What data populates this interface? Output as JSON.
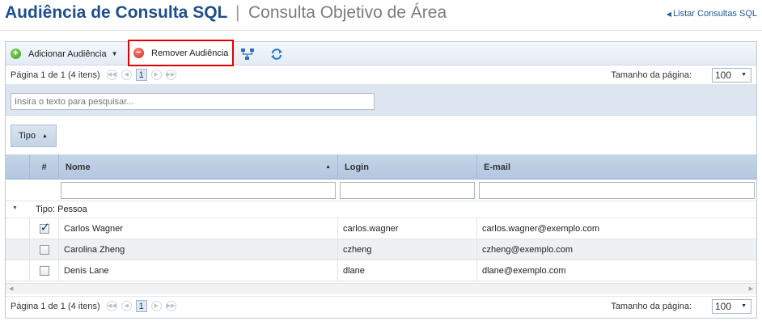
{
  "header": {
    "title": "Audiência de Consulta SQL",
    "separator": "|",
    "subtitle": "Consulta Objetivo de Área",
    "back_link": "Listar Consultas SQL"
  },
  "toolbar": {
    "add_label": "Adicionar Audiência",
    "remove_label": "Remover Audiência"
  },
  "pager": {
    "info": "Página 1 de 1 (4 itens)",
    "current_page": "1",
    "page_size_label": "Tamanho da página:",
    "page_size_value": "100"
  },
  "search": {
    "placeholder": "Insira o texto para pesquisar..."
  },
  "grouping": {
    "chip_label": "Tipo"
  },
  "columns": {
    "number": "#",
    "name": "Nome",
    "login": "Login",
    "email": "E-mail"
  },
  "group": {
    "label": "Tipo: Pessoa"
  },
  "rows": [
    {
      "name": "Carlos Wagner",
      "login": "carlos.wagner",
      "email": "carlos.wagner@exemplo.com",
      "checked": true
    },
    {
      "name": "Carolina Zheng",
      "login": "czheng",
      "email": "czheng@exemplo.com",
      "checked": false
    },
    {
      "name": "Denis Lane",
      "login": "dlane",
      "email": "dlane@exemplo.com",
      "checked": false
    }
  ],
  "colors": {
    "title": "#1e4f8c",
    "highlight_border": "#e00000",
    "header_band": "#b3c7df"
  },
  "icons": {
    "add": "plus-circle-icon",
    "remove": "minus-circle-icon",
    "hierarchy": "hierarchy-icon",
    "refresh": "refresh-icon"
  }
}
